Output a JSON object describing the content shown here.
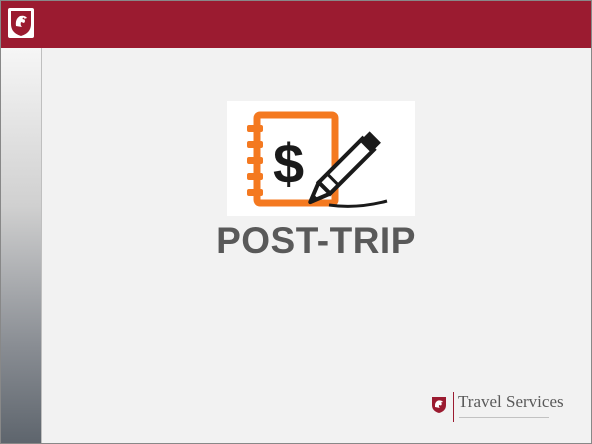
{
  "slide": {
    "title": "POST-TRIP"
  },
  "branding": {
    "department": "Travel Services",
    "corner_logo_icon": "cougar-head-shield-icon",
    "footer_logo_icon": "cougar-head-shield-icon"
  },
  "illustration": {
    "icon": "expense-notebook-pencil-icon",
    "symbol": "$"
  },
  "colors": {
    "brand_crimson": "#9b1b30",
    "illustration_orange": "#f47920",
    "title_gray": "#595959"
  }
}
